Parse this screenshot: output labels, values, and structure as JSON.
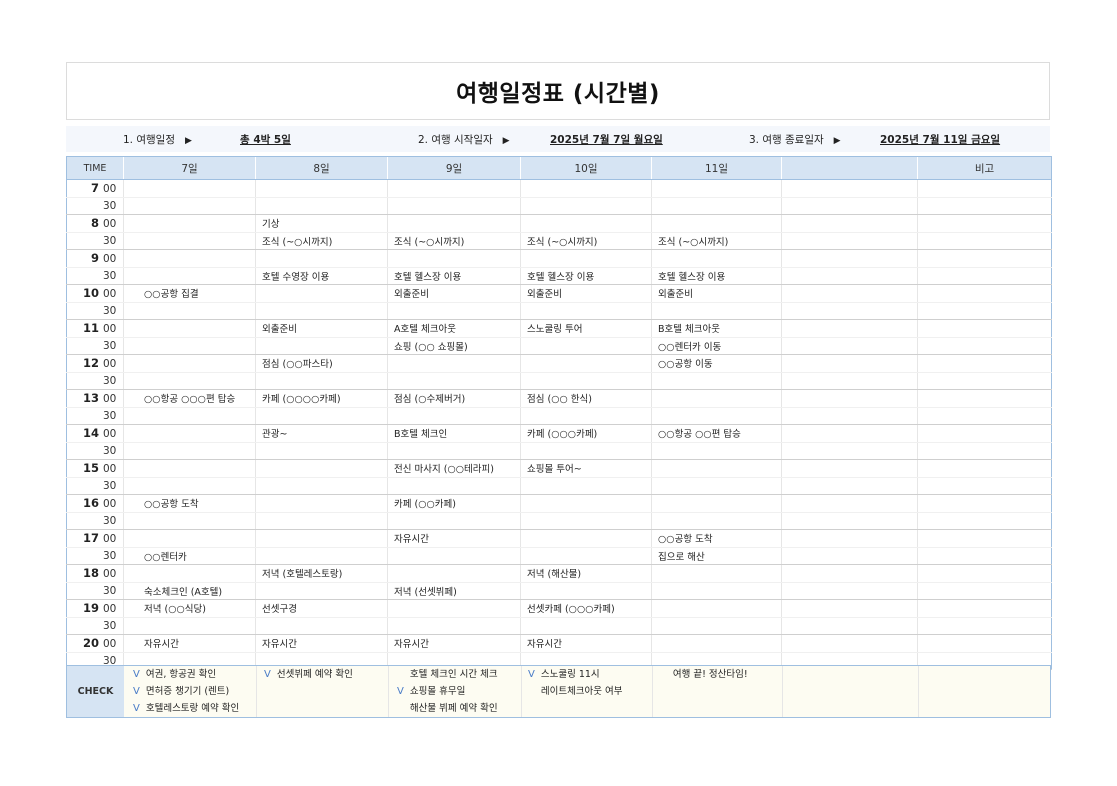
{
  "title": "여행일정표 (시간별)",
  "info": {
    "itinerary_label": "1. 여행일정",
    "itinerary_value": "총 4박 5일",
    "start_label": "2. 여행 시작일자",
    "start_value": "2025년 7월 7일 월요일",
    "end_label": "3. 여행 종료일자",
    "end_value": "2025년 7월 11일 금요일",
    "arrow": "▶"
  },
  "headers": [
    "TIME",
    "7일",
    "8일",
    "9일",
    "10일",
    "11일",
    "",
    "비고"
  ],
  "rows": [
    {
      "hour": "7",
      "min": "00",
      "cells": [
        "",
        "",
        "",
        "",
        ""
      ]
    },
    {
      "hour": "",
      "min": "30",
      "cells": [
        "",
        "",
        "",
        "",
        ""
      ]
    },
    {
      "hour": "8",
      "min": "00",
      "cells": [
        "",
        "기상",
        "",
        "",
        ""
      ]
    },
    {
      "hour": "",
      "min": "30",
      "cells": [
        "",
        "조식 (~○시까지)",
        "조식 (~○시까지)",
        "조식 (~○시까지)",
        "조식 (~○시까지)"
      ]
    },
    {
      "hour": "9",
      "min": "00",
      "cells": [
        "",
        "",
        "",
        "",
        ""
      ]
    },
    {
      "hour": "",
      "min": "30",
      "cells": [
        "",
        "호텔 수영장 이용",
        "호텔 헬스장 이용",
        "호텔 헬스장 이용",
        "호텔 헬스장 이용"
      ]
    },
    {
      "hour": "10",
      "min": "00",
      "cells": [
        "○○공항 집결",
        "",
        "외출준비",
        "외출준비",
        "외출준비"
      ]
    },
    {
      "hour": "",
      "min": "30",
      "cells": [
        "",
        "",
        "",
        "",
        ""
      ]
    },
    {
      "hour": "11",
      "min": "00",
      "cells": [
        "",
        "외출준비",
        "A호텔 체크아웃",
        "스노쿨링 투어",
        "B호텔 체크아웃"
      ]
    },
    {
      "hour": "",
      "min": "30",
      "cells": [
        "",
        "",
        "쇼핑 (○○ 쇼핑몰)",
        "",
        "○○렌터카 이동"
      ]
    },
    {
      "hour": "12",
      "min": "00",
      "cells": [
        "",
        "점심 (○○파스타)",
        "",
        "",
        "○○공항 이동"
      ]
    },
    {
      "hour": "",
      "min": "30",
      "cells": [
        "",
        "",
        "",
        "",
        ""
      ]
    },
    {
      "hour": "13",
      "min": "00",
      "cells": [
        "○○항공 ○○○편 탑승",
        "카페 (○○○○카페)",
        "점심 (○수제버거)",
        "점심 (○○ 한식)",
        ""
      ]
    },
    {
      "hour": "",
      "min": "30",
      "cells": [
        "",
        "",
        "",
        "",
        ""
      ]
    },
    {
      "hour": "14",
      "min": "00",
      "cells": [
        "",
        "관광~",
        "B호텔 체크인",
        "카페 (○○○카페)",
        "○○항공 ○○편 탑승"
      ]
    },
    {
      "hour": "",
      "min": "30",
      "cells": [
        "",
        "",
        "",
        "",
        ""
      ]
    },
    {
      "hour": "15",
      "min": "00",
      "cells": [
        "",
        "",
        "전신 마사지 (○○테라피)",
        "쇼핑몰 투어~",
        ""
      ]
    },
    {
      "hour": "",
      "min": "30",
      "cells": [
        "",
        "",
        "",
        "",
        ""
      ]
    },
    {
      "hour": "16",
      "min": "00",
      "cells": [
        "○○공항 도착",
        "",
        "카페 (○○카페)",
        "",
        ""
      ]
    },
    {
      "hour": "",
      "min": "30",
      "cells": [
        "",
        "",
        "",
        "",
        ""
      ]
    },
    {
      "hour": "17",
      "min": "00",
      "cells": [
        "",
        "",
        "자유시간",
        "",
        "○○공항 도착"
      ]
    },
    {
      "hour": "",
      "min": "30",
      "cells": [
        "○○렌터카",
        "",
        "",
        "",
        "집으로 해산"
      ]
    },
    {
      "hour": "18",
      "min": "00",
      "cells": [
        "",
        "저녁 (호텔레스토랑)",
        "",
        "저녁 (해산물)",
        ""
      ]
    },
    {
      "hour": "",
      "min": "30",
      "cells": [
        "숙소체크인 (A호텔)",
        "",
        "저녁 (선셋뷔페)",
        "",
        ""
      ]
    },
    {
      "hour": "19",
      "min": "00",
      "cells": [
        "저녁 (○○식당)",
        "선셋구경",
        "",
        "선셋카페 (○○○카페)",
        ""
      ]
    },
    {
      "hour": "",
      "min": "30",
      "cells": [
        "",
        "",
        "",
        "",
        ""
      ]
    },
    {
      "hour": "20",
      "min": "00",
      "cells": [
        "자유시간",
        "자유시간",
        "자유시간",
        "자유시간",
        ""
      ]
    },
    {
      "hour": "",
      "min": "30",
      "cells": [
        "",
        "",
        "",
        "",
        ""
      ]
    }
  ],
  "check": {
    "label": "CHECK",
    "mark": "V",
    "items": [
      {
        "text": "여권, 항공권 확인",
        "checked": true
      },
      {
        "text": "면허증 챙기기 (렌트)",
        "checked": true
      },
      {
        "text": "호텔레스토랑 예약 확인",
        "checked": true
      },
      {
        "text": "선셋뷔페 예약 확인",
        "checked": true
      },
      {
        "text": "호텔 체크인 시간 체크",
        "checked": false
      },
      {
        "text": "쇼핑몰 휴무일",
        "checked": true
      },
      {
        "text": "해산물 뷔페 예약 확인",
        "checked": false
      },
      {
        "text": "스노쿨링 11시",
        "checked": true
      },
      {
        "text": "레이트체크아웃 여부",
        "checked": false
      },
      {
        "text": "여행 끝! 정산타임!",
        "checked": false
      }
    ]
  }
}
